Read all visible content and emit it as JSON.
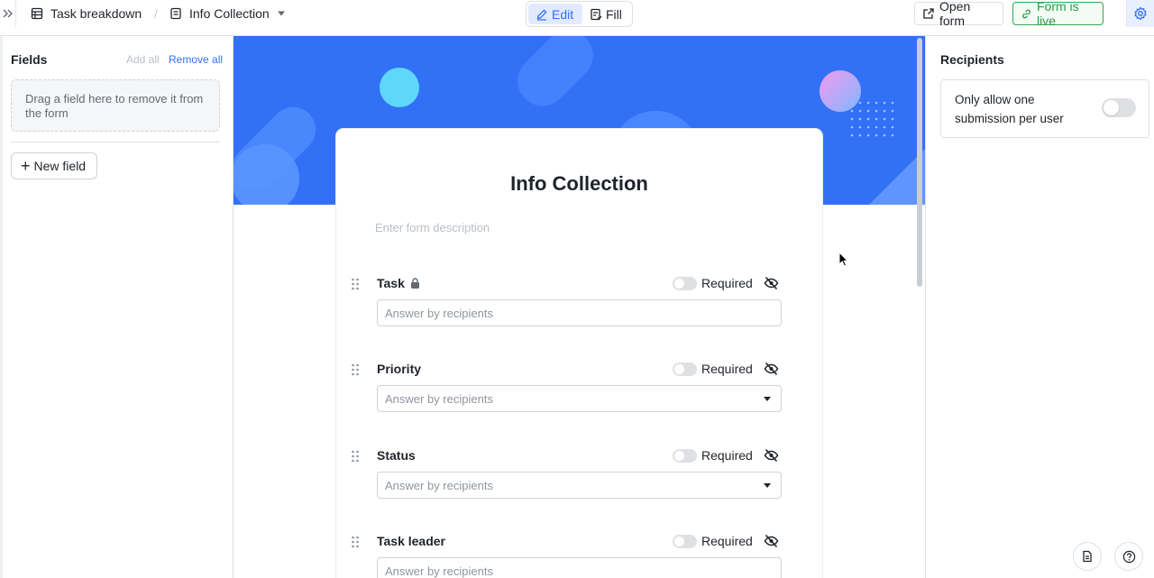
{
  "header": {
    "breadcrumb_table": "Task breakdown",
    "breadcrumb_form": "Info Collection",
    "separator": "/",
    "edit_label": "Edit",
    "fill_label": "Fill",
    "open_form_label": "Open form",
    "form_live_label": "Form is live"
  },
  "left_panel": {
    "title": "Fields",
    "add_all": "Add all",
    "remove_all": "Remove all",
    "drop_hint": "Drag a field here to remove it from the form",
    "new_field_label": "New field"
  },
  "form": {
    "title": "Info Collection",
    "description_placeholder": "Enter form description",
    "required_label": "Required",
    "answer_placeholder": "Answer by recipients",
    "fields": [
      {
        "label": "Task",
        "locked": true,
        "type": "text"
      },
      {
        "label": "Priority",
        "locked": false,
        "type": "select"
      },
      {
        "label": "Status",
        "locked": false,
        "type": "select"
      },
      {
        "label": "Task leader",
        "locked": false,
        "type": "text"
      }
    ]
  },
  "right_panel": {
    "title": "Recipients",
    "one_submission_label": "Only allow one submission per user"
  },
  "colors": {
    "accent": "#3370ff",
    "banner": "#3271f6",
    "live_green": "#2e9a48"
  }
}
